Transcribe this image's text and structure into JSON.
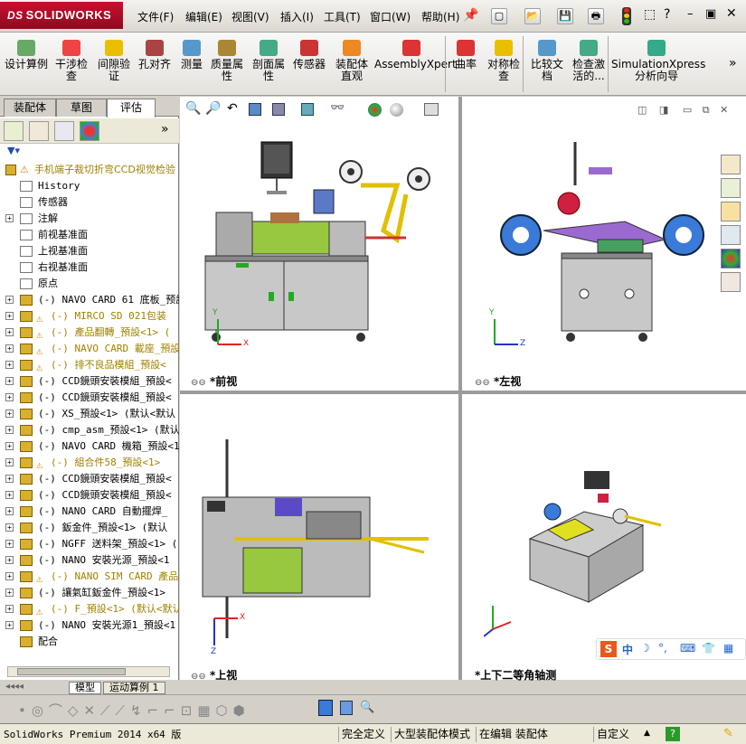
{
  "app": {
    "logo_prefix": "DS",
    "logo_text": "SOLIDWORKS"
  },
  "menu": [
    "文件(F)",
    "编辑(E)",
    "视图(V)",
    "插入(I)",
    "工具(T)",
    "窗口(W)",
    "帮助(H)"
  ],
  "ribbon": {
    "items": [
      {
        "label": "设计算例",
        "icon": "design-study-icon"
      },
      {
        "label": "干涉检查",
        "icon": "interference-icon"
      },
      {
        "label": "间隙验证",
        "icon": "clearance-icon"
      },
      {
        "label": "孔对齐",
        "icon": "hole-align-icon"
      },
      {
        "label": "测量",
        "icon": "measure-icon"
      },
      {
        "label": "质量属性",
        "icon": "mass-props-icon"
      },
      {
        "label": "剖面属性",
        "icon": "section-props-icon"
      },
      {
        "label": "传感器",
        "icon": "sensor-icon"
      },
      {
        "label": "装配体直观",
        "icon": "assembly-visual-icon"
      },
      {
        "label": "AssemblyXpert",
        "icon": "assemblyxpert-icon"
      },
      {
        "label": "曲率",
        "icon": "curvature-icon"
      },
      {
        "label": "对称检查",
        "icon": "symmetry-icon"
      },
      {
        "label": "比较文档",
        "icon": "compare-icon"
      },
      {
        "label": "检查激活的...",
        "icon": "check-icon"
      },
      {
        "label": "SimulationXpress分析向导",
        "icon": "simxpress-icon"
      }
    ]
  },
  "panel": {
    "tabs": [
      "装配体",
      "草图",
      "评估"
    ],
    "active_tab": "评估",
    "root": "手机端子裁切折弯CCD视觉检验",
    "items": [
      {
        "label": "History",
        "exp": false,
        "warn": false,
        "color": "#000000"
      },
      {
        "label": "传感器",
        "exp": false,
        "warn": false,
        "color": "#000000"
      },
      {
        "label": "注解",
        "exp": true,
        "warn": false,
        "color": "#000000"
      },
      {
        "label": "前视基准面",
        "exp": false,
        "warn": false,
        "color": "#000000"
      },
      {
        "label": "上视基准面",
        "exp": false,
        "warn": false,
        "color": "#000000"
      },
      {
        "label": "右视基准面",
        "exp": false,
        "warn": false,
        "color": "#000000"
      },
      {
        "label": "原点",
        "exp": false,
        "warn": false,
        "color": "#000000"
      },
      {
        "label": "(-) NAVO CARD 61 底板_预設",
        "exp": true,
        "warn": false,
        "color": "#000000"
      },
      {
        "label": "(-) MIRCO SD 021包装",
        "exp": true,
        "warn": true,
        "color": "#a08000"
      },
      {
        "label": "(-) 產品翻轉_預設<1> (",
        "exp": true,
        "warn": true,
        "color": "#a08000"
      },
      {
        "label": "(-) NAVO CARD 載座_預設",
        "exp": true,
        "warn": true,
        "color": "#a08000"
      },
      {
        "label": "(-) 排不良品模組_預設<",
        "exp": true,
        "warn": true,
        "color": "#a08000"
      },
      {
        "label": "(-) CCD鏡頭安裝模組_預設<",
        "exp": true,
        "warn": false,
        "color": "#000000"
      },
      {
        "label": "(-) CCD鏡頭安裝模組_預設<",
        "exp": true,
        "warn": false,
        "color": "#000000"
      },
      {
        "label": "(-) XS_預設<1> (默认<默认",
        "exp": true,
        "warn": false,
        "color": "#000000"
      },
      {
        "label": "(-) cmp_asm_预設<1> (默认",
        "exp": true,
        "warn": false,
        "color": "#000000"
      },
      {
        "label": "(-) NAVO CARD 機箱_預設<1",
        "exp": true,
        "warn": false,
        "color": "#000000"
      },
      {
        "label": "(-) 組合件58_預設<1>",
        "exp": true,
        "warn": true,
        "color": "#a08000"
      },
      {
        "label": "(-) CCD鏡頭安裝模組_預設<",
        "exp": true,
        "warn": false,
        "color": "#000000"
      },
      {
        "label": "(-) CCD鏡頭安裝模組_預設<",
        "exp": true,
        "warn": false,
        "color": "#000000"
      },
      {
        "label": "(-) NANO CARD 自動擺焊_",
        "exp": true,
        "warn": false,
        "color": "#000000"
      },
      {
        "label": "(-) 鈑金件_預設<1> (默认",
        "exp": true,
        "warn": false,
        "color": "#000000"
      },
      {
        "label": "(-) NGFF 送料架_預設<1> (",
        "exp": true,
        "warn": false,
        "color": "#000000"
      },
      {
        "label": "(-) NANO 安裝光源_預設<1",
        "exp": true,
        "warn": false,
        "color": "#000000"
      },
      {
        "label": "(-) NANO SIM CARD 產品",
        "exp": true,
        "warn": true,
        "color": "#a08000"
      },
      {
        "label": "(-) 讓氣缸鈑金件_預設<1>",
        "exp": true,
        "warn": false,
        "color": "#000000"
      },
      {
        "label": "(-) F_預設<1> (默认<默认",
        "exp": true,
        "warn": true,
        "color": "#a08000"
      },
      {
        "label": "(-) NANO 安裝光源1_預設<1",
        "exp": true,
        "warn": false,
        "color": "#000000"
      },
      {
        "label": "配合",
        "exp": false,
        "warn": false,
        "color": "#000000"
      }
    ]
  },
  "views": {
    "front": "*前视",
    "left": "*左视",
    "top": "*上视",
    "iso": "*上下二等角轴测"
  },
  "bottom_tabs": [
    "模型",
    "运动算例 1"
  ],
  "status": {
    "version": "SolidWorks Premium 2014 x64 版",
    "defined": "完全定义",
    "mode": "大型装配体模式",
    "editing": "在编辑 装配体",
    "units": "自定义"
  },
  "axis": {
    "x": "X",
    "y": "Y",
    "z": "Z"
  },
  "ime": "S中"
}
